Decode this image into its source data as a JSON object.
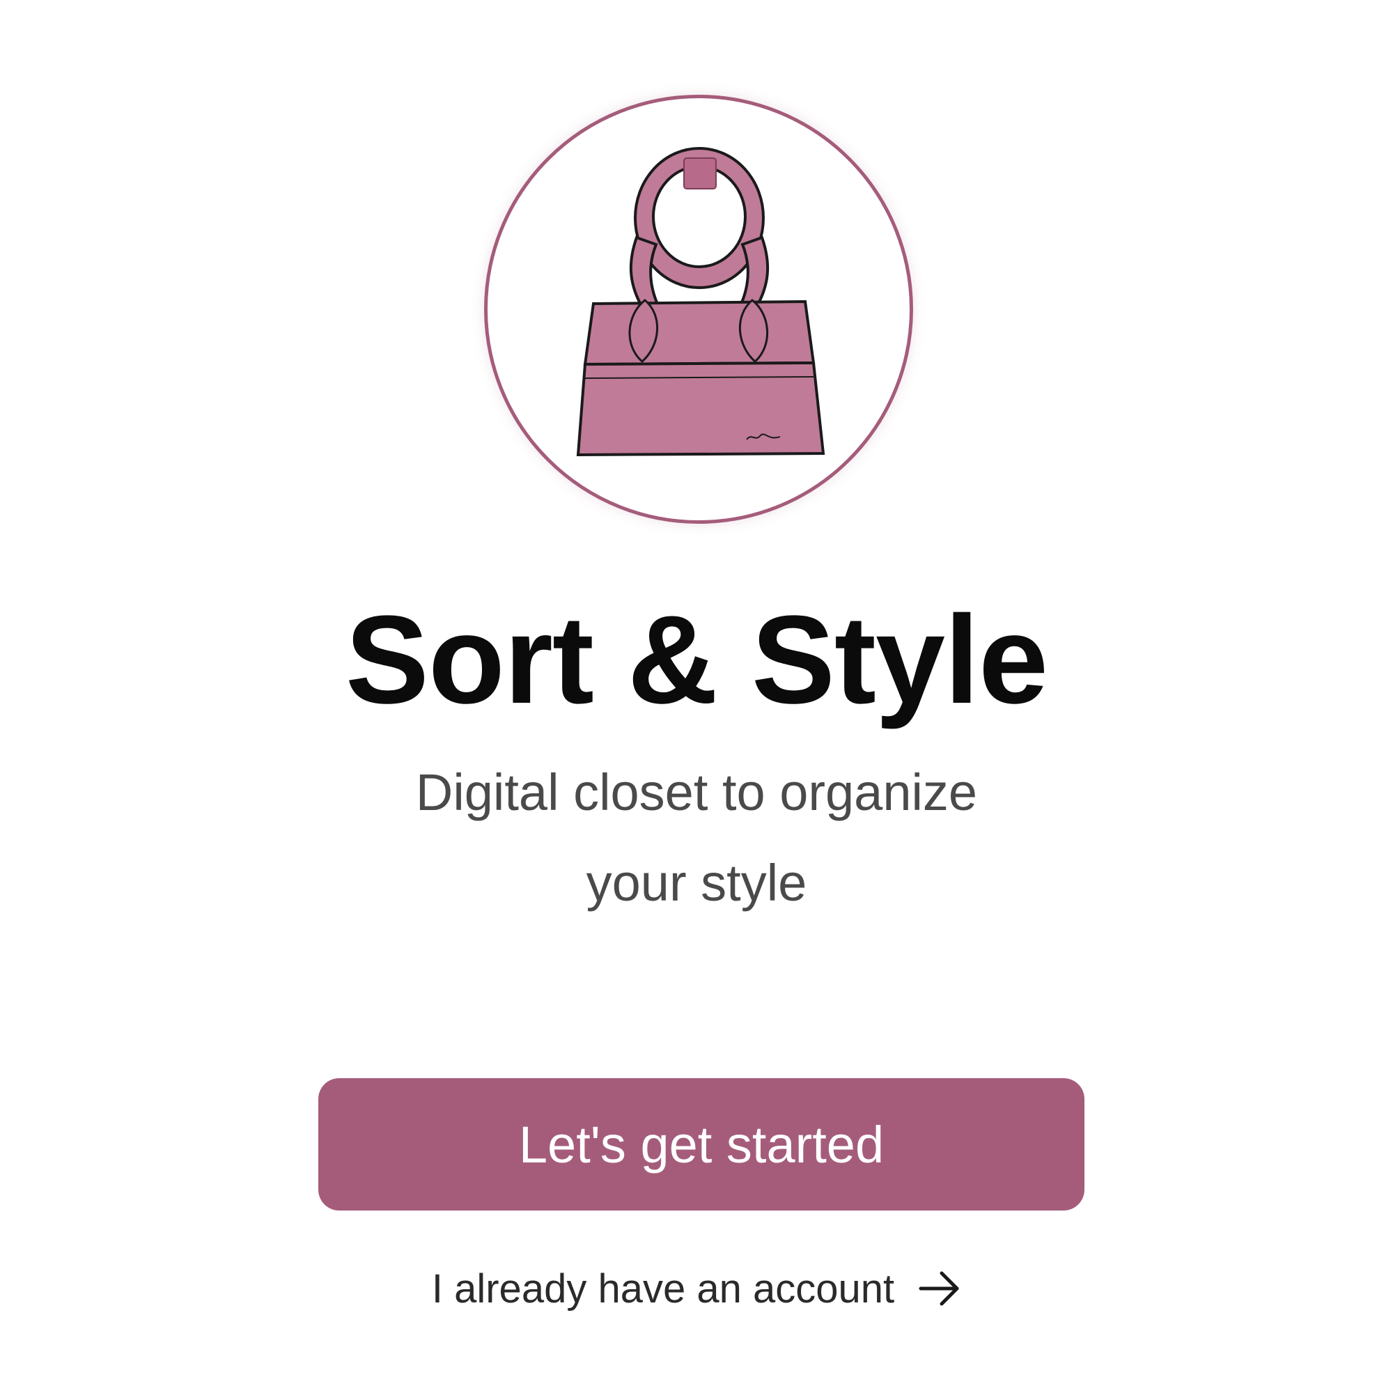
{
  "app": {
    "title": "Sort & Style",
    "subtitle_line1": "Digital closet to organize",
    "subtitle_line2": "your style"
  },
  "actions": {
    "primary_label": "Let's get started",
    "secondary_label": "I already have an account",
    "secondary_icon": "arrow-right-icon"
  },
  "logo": {
    "icon": "handbag-icon"
  },
  "colors": {
    "accent": "#a55c7b",
    "bag_fill": "#c07b98",
    "background": "#ffffff",
    "title": "#0b0b0b",
    "subtitle": "#4a4a4a"
  }
}
